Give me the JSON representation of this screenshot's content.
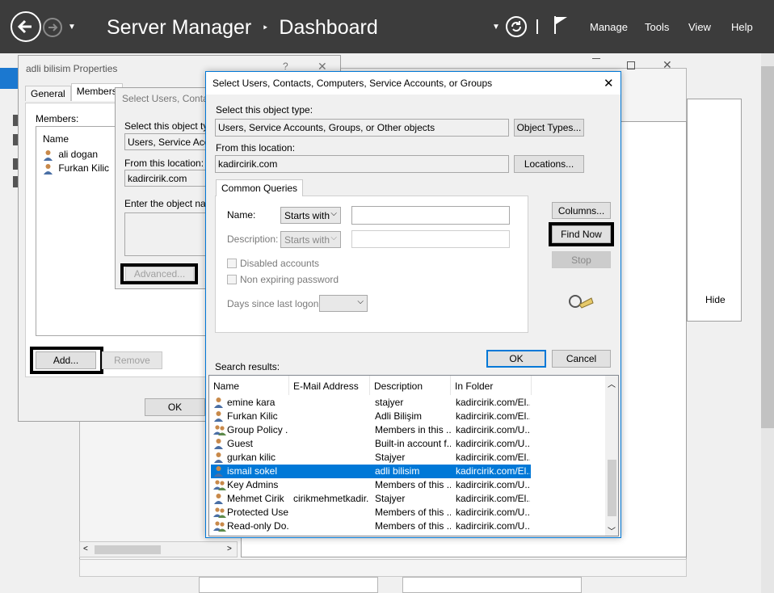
{
  "topbar": {
    "app_title": "Server Manager",
    "separator": "‣",
    "page_title": "Dashboard",
    "menu": [
      "Manage",
      "Tools",
      "View",
      "Help"
    ]
  },
  "background": {
    "hide_label": "Hide"
  },
  "properties_dialog": {
    "title": "adli bilisim Properties",
    "help": "?",
    "close": "✕",
    "tabs": [
      "General",
      "Members"
    ],
    "members_label": "Members:",
    "column_name": "Name",
    "members": [
      "ali dogan",
      "Furkan Kilic"
    ],
    "add_label": "Add...",
    "remove_label": "Remove",
    "ok_label": "OK"
  },
  "mid_dialog": {
    "title": "Select Users, Contac",
    "object_type_label": "Select this object type",
    "object_type_value": "Users, Service Acco",
    "location_label": "From this location:",
    "location_value": "kadircirik.com",
    "enter_label": "Enter the object name",
    "advanced_label": "Advanced..."
  },
  "select_dialog": {
    "title": "Select Users, Contacts, Computers, Service Accounts, or Groups",
    "close": "✕",
    "object_type_label": "Select this object type:",
    "object_type_value": "Users, Service Accounts, Groups, or Other objects",
    "object_types_button": "Object Types...",
    "location_label": "From this location:",
    "location_value": "kadircirik.com",
    "locations_button": "Locations...",
    "tab_common_queries": "Common Queries",
    "name_label": "Name:",
    "name_filter": "Starts with",
    "name_value": "",
    "description_label": "Description:",
    "description_filter": "Starts with",
    "description_value": "",
    "disabled_accounts": "Disabled accounts",
    "non_expiring_password": "Non expiring password",
    "days_since_logon": "Days since last logon:",
    "days_value": "",
    "columns_button": "Columns...",
    "find_now_button": "Find Now",
    "stop_button": "Stop",
    "ok_button": "OK",
    "cancel_button": "Cancel",
    "search_results_label": "Search results:",
    "result_columns": [
      "Name",
      "E-Mail Address",
      "Description",
      "In Folder"
    ],
    "results": [
      {
        "name": "emine kara",
        "email": "",
        "description": "stajyer",
        "folder": "kadircirik.com/El...",
        "type": "user"
      },
      {
        "name": "Furkan Kilic",
        "email": "",
        "description": "Adli Bilişim",
        "folder": "kadircirik.com/El...",
        "type": "user"
      },
      {
        "name": "Group Policy ...",
        "email": "",
        "description": "Members in this ...",
        "folder": "kadircirik.com/U...",
        "type": "group"
      },
      {
        "name": "Guest",
        "email": "",
        "description": "Built-in account f...",
        "folder": "kadircirik.com/U...",
        "type": "user"
      },
      {
        "name": "gurkan kilic",
        "email": "",
        "description": "Stajyer",
        "folder": "kadircirik.com/El...",
        "type": "user"
      },
      {
        "name": "ismail sokel",
        "email": "",
        "description": "adli bilisim",
        "folder": "kadircirik.com/El...",
        "type": "user",
        "selected": true
      },
      {
        "name": "Key Admins",
        "email": "",
        "description": "Members of this ...",
        "folder": "kadircirik.com/U...",
        "type": "group"
      },
      {
        "name": "Mehmet Cirik",
        "email": "cirikmehmetkadir...",
        "description": "Stajyer",
        "folder": "kadircirik.com/El...",
        "type": "user"
      },
      {
        "name": "Protected Users",
        "email": "",
        "description": "Members of this ...",
        "folder": "kadircirik.com/U...",
        "type": "group"
      },
      {
        "name": "Read-only Do...",
        "email": "",
        "description": "Members of this ...",
        "folder": "kadircirik.com/U...",
        "type": "group"
      }
    ]
  },
  "colors": {
    "topbar": "#3c3c3c",
    "accent": "#0078d7",
    "selection": "#0078d7"
  },
  "icons": {
    "back": "back-arrow-icon",
    "forward": "forward-arrow-icon",
    "refresh": "refresh-icon",
    "flag": "flag-icon",
    "search": "find-flashlight-icon"
  }
}
